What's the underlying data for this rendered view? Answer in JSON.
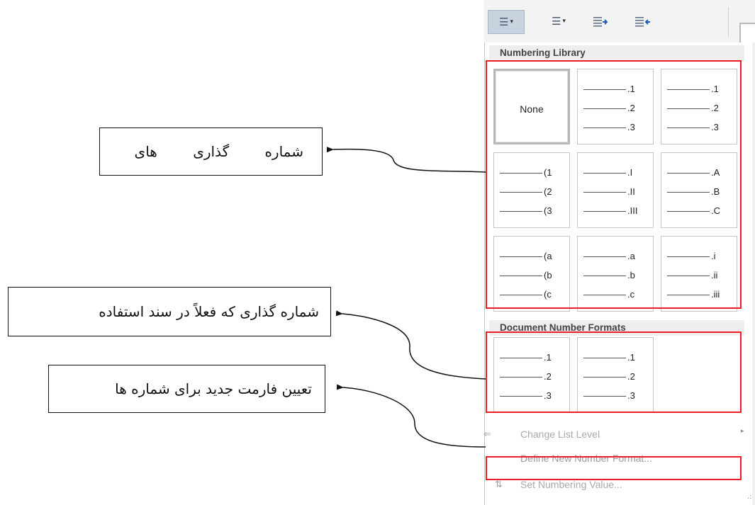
{
  "ribbon": {
    "buttons": [
      {
        "name": "numbering-button",
        "glyph": "☰",
        "caret": "▾",
        "active": true
      },
      {
        "name": "multilevel-list-button",
        "glyph": "☰",
        "caret": "▾",
        "active": false
      },
      {
        "name": "decrease-indent-button",
        "glyph": "⇤",
        "caret": "",
        "active": false
      },
      {
        "name": "increase-indent-button",
        "glyph": "⇥",
        "caret": "",
        "active": false
      }
    ]
  },
  "menu": {
    "numbering_library": {
      "header": "Numbering Library",
      "tiles": [
        {
          "type": "none",
          "label": "None"
        },
        {
          "type": "list",
          "items": [
            ".1",
            ".2",
            ".3"
          ]
        },
        {
          "type": "list",
          "items": [
            ".1",
            ".2",
            ".3"
          ]
        },
        {
          "type": "list",
          "items": [
            "(1",
            "(2",
            "(3"
          ]
        },
        {
          "type": "list",
          "items": [
            ".I",
            ".II",
            ".III"
          ]
        },
        {
          "type": "list",
          "items": [
            ".A",
            ".B",
            ".C"
          ]
        },
        {
          "type": "list",
          "items": [
            "(a",
            "(b",
            "(c"
          ]
        },
        {
          "type": "list",
          "items": [
            ".a",
            ".b",
            ".c"
          ]
        },
        {
          "type": "list",
          "items": [
            ".i",
            ".ii",
            ".iii"
          ]
        }
      ]
    },
    "document_formats": {
      "header": "Document Number Formats",
      "tiles": [
        {
          "type": "list",
          "items": [
            ".1",
            ".2",
            ".3"
          ]
        },
        {
          "type": "list",
          "items": [
            ".1",
            ".2",
            ".3"
          ]
        }
      ]
    },
    "items": {
      "change_list_level": "Change List Level",
      "define_new_format": "Define New Number Format...",
      "set_numbering_value": "Set Numbering Value..."
    }
  },
  "annotations": {
    "numbering_library": "شماره گذاری های",
    "document_formats": "شماره گذاری که فعلاً در سند استفاده",
    "define_new_format": "تعیین فارمت جدید برای شماره ها"
  },
  "colors": {
    "highlight": "#ee1c24",
    "ribbon_bg": "#f3f3f3",
    "header_bg": "#eeeeee"
  }
}
